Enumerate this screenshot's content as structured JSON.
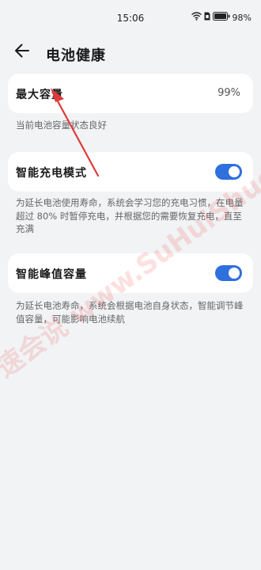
{
  "status_bar": {
    "time": "15:06",
    "battery_percent": "98%"
  },
  "header": {
    "title": "电池健康"
  },
  "max_capacity": {
    "label": "最大容量",
    "value": "99%",
    "note": "当前电池容量状态良好"
  },
  "smart_charge": {
    "label": "智能充电模式",
    "enabled": true,
    "note": "为延长电池使用寿命，系统会学习您的充电习惯，在电量超过 80% 时暂停充电，并根据您的需要恢复充电，直至充满"
  },
  "smart_peak": {
    "label": "智能峰值容量",
    "enabled": true,
    "note": "为延长电池寿命，系统会根据电池自身状态，智能调节峰值容量，可能影响电池续航"
  },
  "watermark": {
    "text": "速会说 www.SuHuiShuo.com"
  },
  "colors": {
    "accent": "#2f6fde",
    "annotation_arrow": "#e03a3a"
  }
}
